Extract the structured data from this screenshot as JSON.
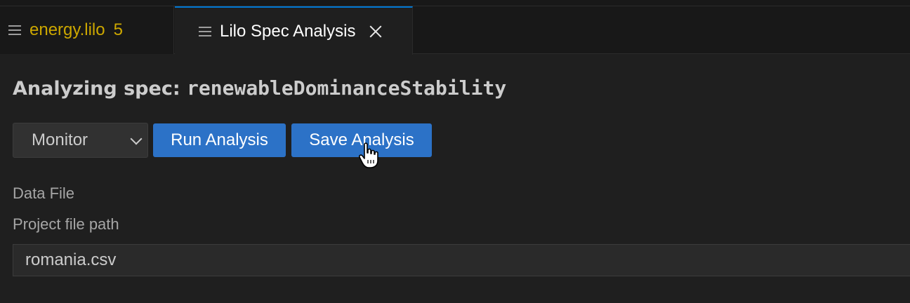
{
  "tabs": [
    {
      "label": "energy.lilo",
      "badge": "5",
      "icon": "lines-icon"
    },
    {
      "label": "Lilo Spec Analysis",
      "icon": "lines-icon",
      "close": "close-icon"
    }
  ],
  "page": {
    "title_prefix": "Analyzing spec: ",
    "spec_name": "renewableDominanceStability"
  },
  "toolbar": {
    "mode_selected": "Monitor",
    "run_label": "Run Analysis",
    "save_label": "Save Analysis"
  },
  "form": {
    "data_file_label": "Data File",
    "path_label": "Project file path",
    "path_value": "romania.csv"
  },
  "colors": {
    "accent": "#0078d4",
    "button": "#2c72c7",
    "modified": "#cca700",
    "background": "#1f1f1f"
  }
}
